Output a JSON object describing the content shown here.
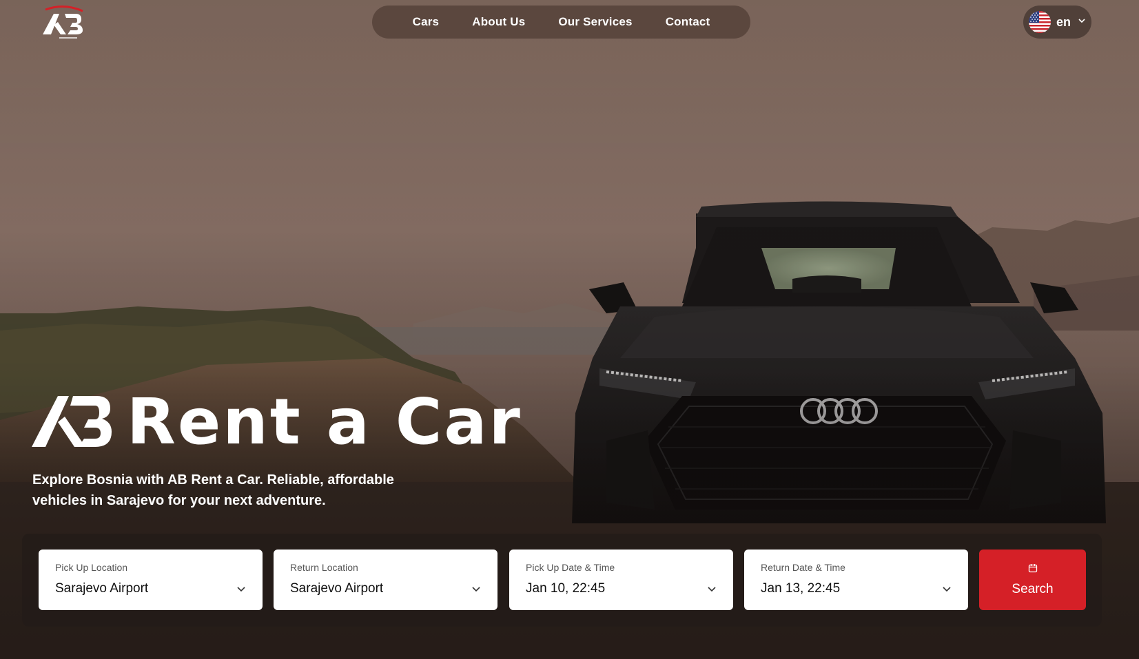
{
  "brand": {
    "name": "AB Rent a Car",
    "hero_title": "Rent a Car",
    "tagline": "Explore Bosnia with AB Rent a Car. Reliable, affordable vehicles in Sarajevo for your next adventure."
  },
  "nav": {
    "items": [
      {
        "label": "Cars"
      },
      {
        "label": "About Us"
      },
      {
        "label": "Our Services"
      },
      {
        "label": "Contact"
      }
    ]
  },
  "language": {
    "code": "en",
    "flag_icon": "us-flag-icon"
  },
  "search": {
    "pickup_location": {
      "label": "Pick Up Location",
      "value": "Sarajevo Airport"
    },
    "return_location": {
      "label": "Return Location",
      "value": "Sarajevo Airport"
    },
    "pickup_datetime": {
      "label": "Pick Up Date & Time",
      "value": "Jan 10, 22:45"
    },
    "return_datetime": {
      "label": "Return Date & Time",
      "value": "Jan 13, 22:45"
    },
    "button_label": "Search",
    "button_icon": "calendar-icon"
  },
  "colors": {
    "accent": "#d52027",
    "nav_bg": "#58443c",
    "panel_bg": "#231b18"
  }
}
